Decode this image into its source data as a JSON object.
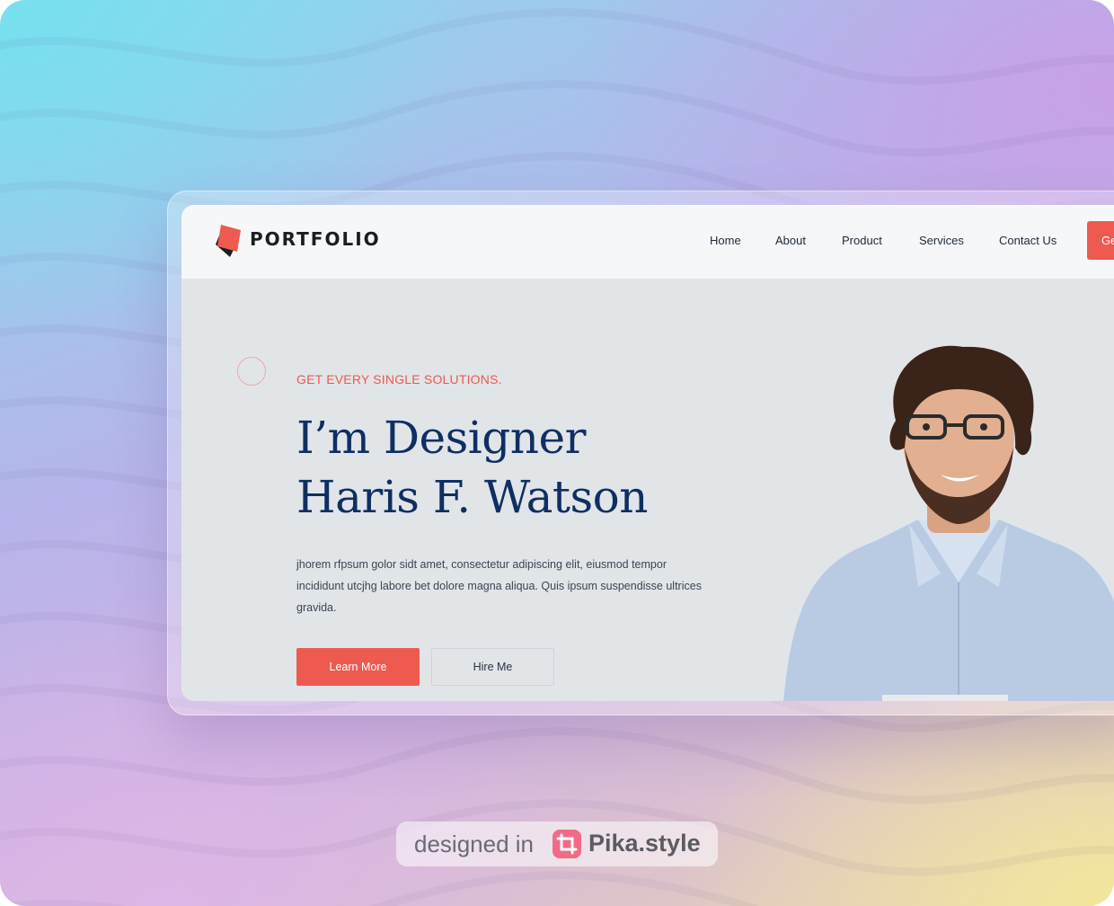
{
  "site": {
    "logo_text": "PORTFOLIO",
    "nav": [
      "Home",
      "About",
      "Product",
      "Services",
      "Contact Us"
    ],
    "nav_cta": "Ge",
    "hero": {
      "eyebrow": "GET EVERY SINGLE SOLUTIONS.",
      "headline_line1": "I’m Designer",
      "headline_line2": "Haris F. Watson",
      "paragraph": "jhorem rfpsum golor sidt amet, consectetur adipiscing elit, eiusmod tempor incididunt utcjhg labore bet dolore magna aliqua. Quis ipsum suspendisse ultrices gravida.",
      "primary_button": "Learn More",
      "secondary_button": "Hire Me"
    }
  },
  "badge": {
    "prefix": "designed in",
    "brand": "Pika.style",
    "icon": "crop-icon"
  },
  "colors": {
    "accent": "#ee5a4f",
    "headline": "#0f2f63",
    "hero_bg": "#e2e5e8",
    "nav_bg": "#f6f7f9"
  }
}
